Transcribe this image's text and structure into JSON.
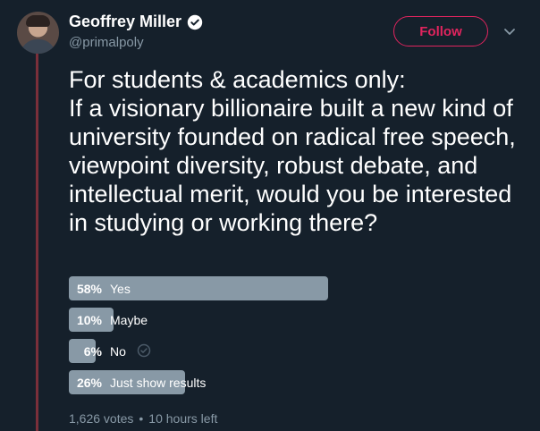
{
  "user": {
    "display_name": "Geoffrey Miller",
    "handle": "@primalpoly",
    "verified": true,
    "avatar": "profile-photo"
  },
  "actions": {
    "follow_label": "Follow",
    "menu_icon": "chevron-down-icon"
  },
  "tweet": {
    "line1": "For students & academics only:",
    "line2": "If a visionary billionaire built a new kind of university founded on radical free speech, viewpoint diversity, robust debate, and intellectual merit, would you be interested in studying or working there?"
  },
  "poll": {
    "options": [
      {
        "percent_text": "58%",
        "percent": 58,
        "label": "Yes"
      },
      {
        "percent_text": "10%",
        "percent": 10,
        "label": "Maybe"
      },
      {
        "percent_text": "6%",
        "percent": 6,
        "label": "No"
      },
      {
        "percent_text": "26%",
        "percent": 26,
        "label": "Just show results"
      }
    ],
    "votes": "1,626 votes",
    "separator": "•",
    "time_left": "10 hours left"
  },
  "colors": {
    "background": "#15202b",
    "accent": "#e0245e",
    "poll_bar": "#8899a6",
    "muted_text": "#8899a6"
  }
}
